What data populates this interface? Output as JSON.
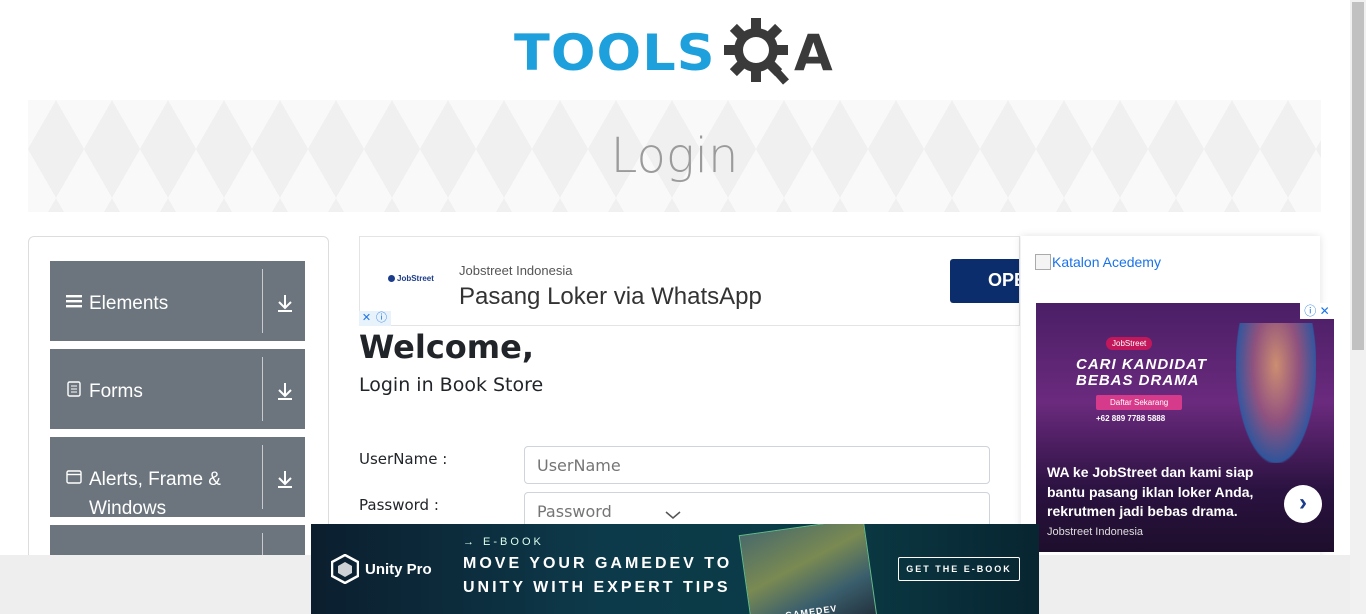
{
  "header": {
    "logo_text": "TOOLS",
    "logo_suffix": "A",
    "logo_color": "#1ea0dc"
  },
  "banner": {
    "title": "Login"
  },
  "sidebar": {
    "groups": [
      {
        "label": "Elements",
        "icon": "menu-lines-icon"
      },
      {
        "label": "Forms",
        "icon": "document-icon"
      },
      {
        "label": "Alerts, Frame & Windows",
        "icon": "window-icon"
      },
      {
        "label": "",
        "icon": ""
      }
    ]
  },
  "ad_top": {
    "brand": "JobStreet",
    "sponsor": "Jobstreet Indonesia",
    "headline": "Pasang Loker via WhatsApp",
    "button": "OPE"
  },
  "main": {
    "welcome": "Welcome,",
    "subtitle": "Login in Book Store",
    "username_label": "UserName :",
    "username_placeholder": "UserName",
    "password_label": "Password :",
    "password_placeholder": "Password"
  },
  "right": {
    "katalon_alt": "Katalon Acedemy",
    "ad": {
      "badge": "JobStreet",
      "big_text": "CARI KANDIDAT BEBAS DRAMA",
      "daftar": "Daftar Sekarang",
      "phone": "+62 889 7788 5888",
      "body": "WA ke JobStreet dan kami siap bantu pasang iklan loker Anda, rekrutmen jadi bebas drama.",
      "source": "Jobstreet Indonesia"
    }
  },
  "bottom_ad": {
    "brand": "Unity Pro",
    "kicker": "→ E-BOOK",
    "headline_1": "MOVE YOUR GAMEDEV TO",
    "headline_2": "UNITY WITH EXPERT TIPS",
    "book_text": "GAMEDEV",
    "cta": "GET THE E-BOOK"
  }
}
